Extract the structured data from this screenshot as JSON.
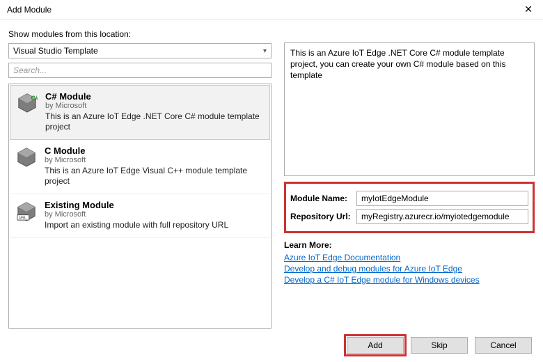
{
  "window": {
    "title": "Add Module"
  },
  "location": {
    "label": "Show modules from this location:",
    "selected": "Visual Studio Template"
  },
  "search": {
    "placeholder": "Search..."
  },
  "modules": [
    {
      "title": "C# Module",
      "author": "by Microsoft",
      "desc": "This is an Azure IoT Edge .NET Core C# module template project",
      "icon": "csharp-cube",
      "selected": true
    },
    {
      "title": "C Module",
      "author": "by Microsoft",
      "desc": "This is an Azure IoT Edge Visual C++ module template project",
      "icon": "cube",
      "selected": false
    },
    {
      "title": "Existing Module",
      "author": "by Microsoft",
      "desc": "Import an existing module with full repository URL",
      "icon": "url-cube",
      "selected": false
    }
  ],
  "description": "This is an Azure IoT Edge .NET Core C# module template project, you can create your own C# module based on this template",
  "form": {
    "name_label": "Module Name:",
    "name_value": "myIotEdgeModule",
    "repo_label": "Repository Url:",
    "repo_value": "myRegistry.azurecr.io/myiotedgemodule"
  },
  "learn": {
    "title": "Learn More:",
    "links": [
      "Azure IoT Edge Documentation",
      "Develop and debug modules for Azure IoT Edge",
      "Develop a C# IoT Edge module for Windows devices"
    ]
  },
  "buttons": {
    "add": "Add",
    "skip": "Skip",
    "cancel": "Cancel"
  }
}
